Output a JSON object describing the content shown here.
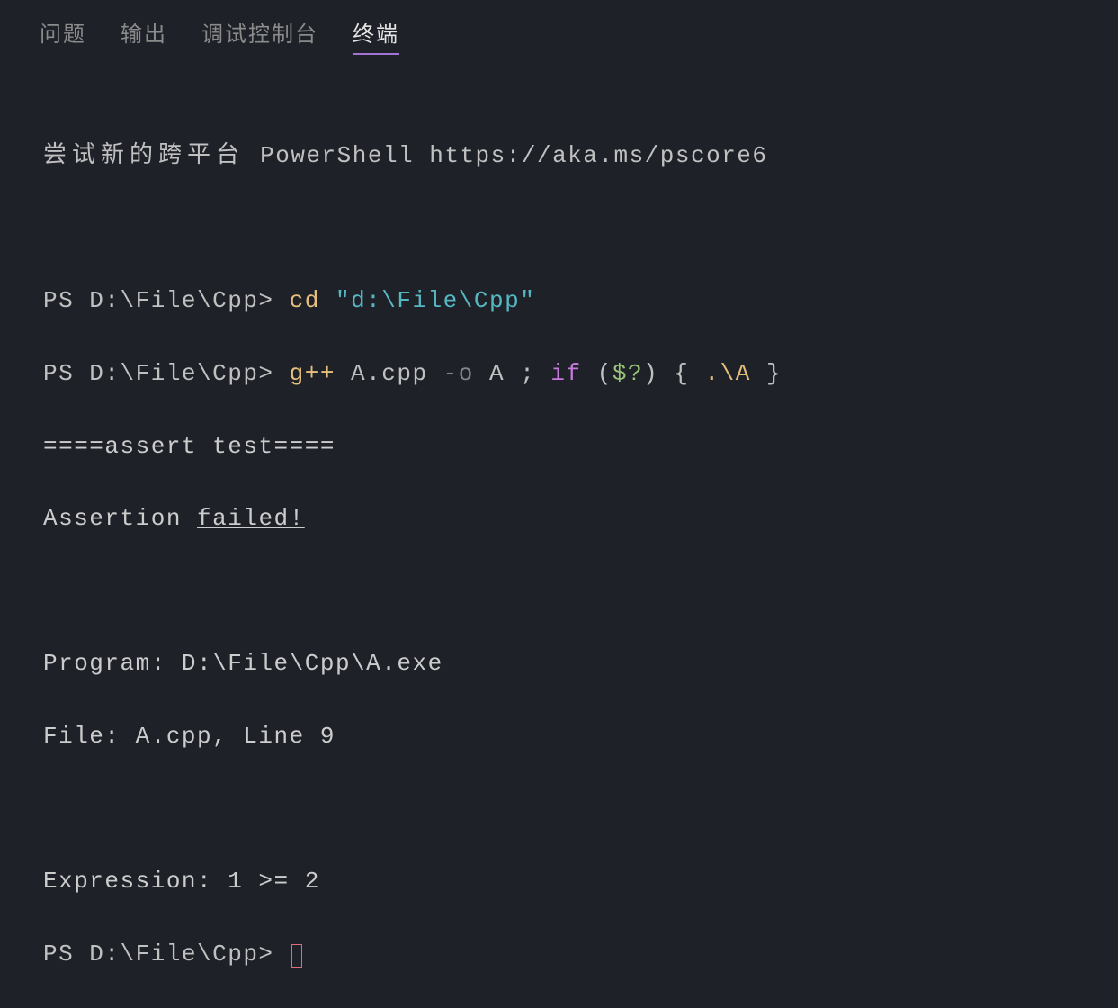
{
  "tabs": {
    "problems": "问题",
    "output": "输出",
    "debug_console": "调试控制台",
    "terminal": "终端"
  },
  "banner": {
    "cn": "尝试新的跨平台",
    "latin": " PowerShell https://aka.ms/pscore6"
  },
  "line1": {
    "prompt": "PS D:\\File\\Cpp> ",
    "cd": "cd",
    "path": " \"d:\\File\\Cpp\""
  },
  "line2": {
    "prompt": "PS D:\\File\\Cpp> ",
    "gpp": "g++",
    "args1": " A.cpp ",
    "dash_o": "-o",
    "args2": " A ",
    "semi": ";",
    "sp1": " ",
    "if_kw": "if",
    "sp2": " ",
    "paren_o": "(",
    "var": "$?",
    "paren_c": ")",
    "sp3": " ",
    "brace_o": "{",
    "sp4": " ",
    "run": ".\\A",
    "sp5": " ",
    "brace_c": "}"
  },
  "out": {
    "l1": "====assert test====",
    "l2a": "Assertion ",
    "l2b": "failed!",
    "l3": "Program: D:\\File\\Cpp\\A.exe",
    "l4": "File: A.cpp, Line 9",
    "l5": "Expression: 1 >= 2"
  },
  "final_prompt": "PS D:\\File\\Cpp> "
}
